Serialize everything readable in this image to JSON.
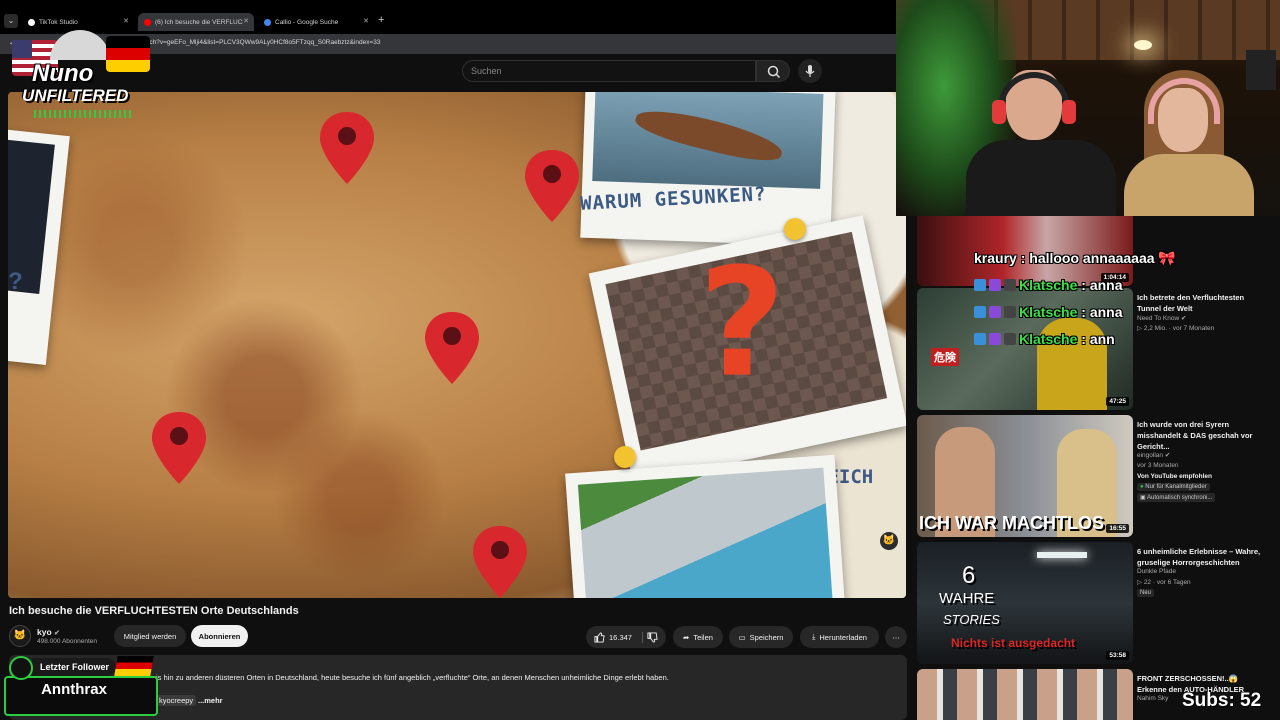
{
  "browser": {
    "tabs": [
      {
        "label": "TikTok Studio",
        "fav_color": "#ffffff"
      },
      {
        "label": "(6) Ich besuche die VERFLUCHT",
        "fav_color": "#ff0000"
      },
      {
        "label": "Callio - Google Suche",
        "fav_color": "#4285f4"
      }
    ],
    "url": "m/watch?v=geEFo_Mlji4&list=PLCV3QWw9ALy0HCf8o5FTzqq_S0Raebztz&index=33"
  },
  "overlay": {
    "logo_line1": "Nuno",
    "logo_line2": "UNFILTERED",
    "follower_label": "Letzter Follower",
    "follower_name": "Annthrax",
    "subs": "Subs: 52"
  },
  "youtube": {
    "search_placeholder": "Suchen",
    "video": {
      "caption_top": "WARUM GESUNKEN?",
      "caption_side": "LEICH",
      "caption_left": "?",
      "qmark": "?",
      "title": "Ich besuche die VERFLUCHTESTEN Orte Deutschlands"
    },
    "channel": {
      "name": "kyo",
      "subscribers": "498.000 Abonnenten"
    },
    "buttons": {
      "member": "Mitglied werden",
      "subscribe": "Abonnieren",
      "likes": "16.347",
      "share": "Teilen",
      "save": "Speichern",
      "download": "Herunterladen"
    },
    "description": {
      "text": "is hin zu anderen düsteren Orten in Deutschland, heute besuche ich fünf angeblich „verfluchte“ Orte, an denen Menschen unheimliche Dinge erlebt haben.",
      "tag": "kyocreepy",
      "more": "...mehr"
    }
  },
  "sidebar": [
    {
      "duration": "1:04:14"
    },
    {
      "title": "Ich betrete den Verfluchtesten Tunnel der Welt",
      "channel": "Need To Know",
      "meta": "2,2 Mio. · vor 7 Monaten",
      "duration": "47:25",
      "thumb_text": "危険"
    },
    {
      "title": "Ich wurde von drei Syrern misshandelt & DAS geschah vor Gericht...",
      "channel": "eingollan",
      "meta": "vor 3 Monaten",
      "extra": "Von YouTube empfohlen",
      "badge1": "Nur für Kanalmitglieder",
      "badge2": "Automatisch synchroni...",
      "duration": "16:55",
      "thumb_text": "ICH WAR MACHTLOS"
    },
    {
      "title": "6 unheimliche Erlebnisse – Wahre, gruselige Horrorgeschichten",
      "channel": "Dunkle Pfade",
      "meta": "22 · vor 6 Tagen",
      "badge1": "Neu",
      "duration": "53:58",
      "thumb_num": "6",
      "thumb_l1": "WAHRE",
      "thumb_l2": "STORIES",
      "thumb_l3": "Nichts ist ausgedacht"
    },
    {
      "title": "FRONT ZERSCHOSSEN!..😱 Erkenne den AUTO-HÄNDLER",
      "channel": "Nahim Sky"
    }
  ],
  "chat": [
    {
      "user": "kraury",
      "message": "hallooo annaaaaaa 🎀",
      "color": "#ffffff"
    },
    {
      "user": "Klatsche",
      "message": "anna",
      "color": "#3ee04a"
    },
    {
      "user": "Klatsche",
      "message": "anna",
      "color": "#3ee04a"
    },
    {
      "user": "Klatsche",
      "message": "ann",
      "color": "#3ee04a"
    }
  ],
  "colors": {
    "accent_green": "#2ecc40",
    "yt_red": "#ff0000",
    "pin_red": "#d9272e"
  }
}
